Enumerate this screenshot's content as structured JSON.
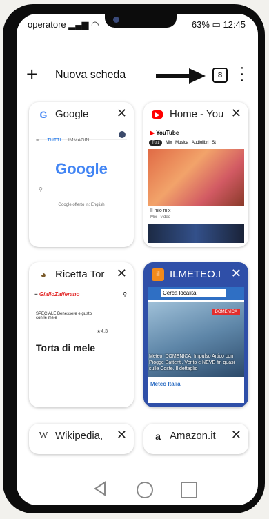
{
  "status": {
    "operator": "operatore",
    "battery": "63%",
    "time": "12:45"
  },
  "toolbar": {
    "new_tab_label": "Nuova scheda",
    "tab_count": "8"
  },
  "tabs": [
    {
      "title": "Google",
      "content": {
        "logo": "Google",
        "links": [
          "TUTTI",
          "IMMAGINI"
        ],
        "footer": "Google offerto in:  English"
      }
    },
    {
      "title": "Home - You",
      "content": {
        "brand": "YouTube",
        "chips": [
          "Tutti",
          "Mix",
          "Musica",
          "Audiolibri",
          "St"
        ],
        "video_title": "Il mio mix",
        "video_sub": "Mix · video"
      }
    },
    {
      "title": "Ricetta Tor",
      "content": {
        "site": "GialloZafferano",
        "banner": "SPECIALE Benessere e gusto con le mele",
        "rating": "4,3",
        "heading": "Torta di mele"
      }
    },
    {
      "title": "ILMETEO.I",
      "content": {
        "search": "Cerca località",
        "day": "DOMENICA",
        "headline": "Meteo: DOMENICA, Impulso Artico con Piogge Battenti, Vento e NEVE fin quasi sulle Coste. Il dettaglio",
        "footer": "Meteo Italia"
      }
    },
    {
      "title": "Wikipedia,"
    },
    {
      "title": "Amazon.it"
    }
  ],
  "colors": {
    "accent": "#2f4fa8",
    "google_red": "#ea4335",
    "youtube_red": "#ff0000",
    "meteo_orange": "#f28a1b"
  }
}
